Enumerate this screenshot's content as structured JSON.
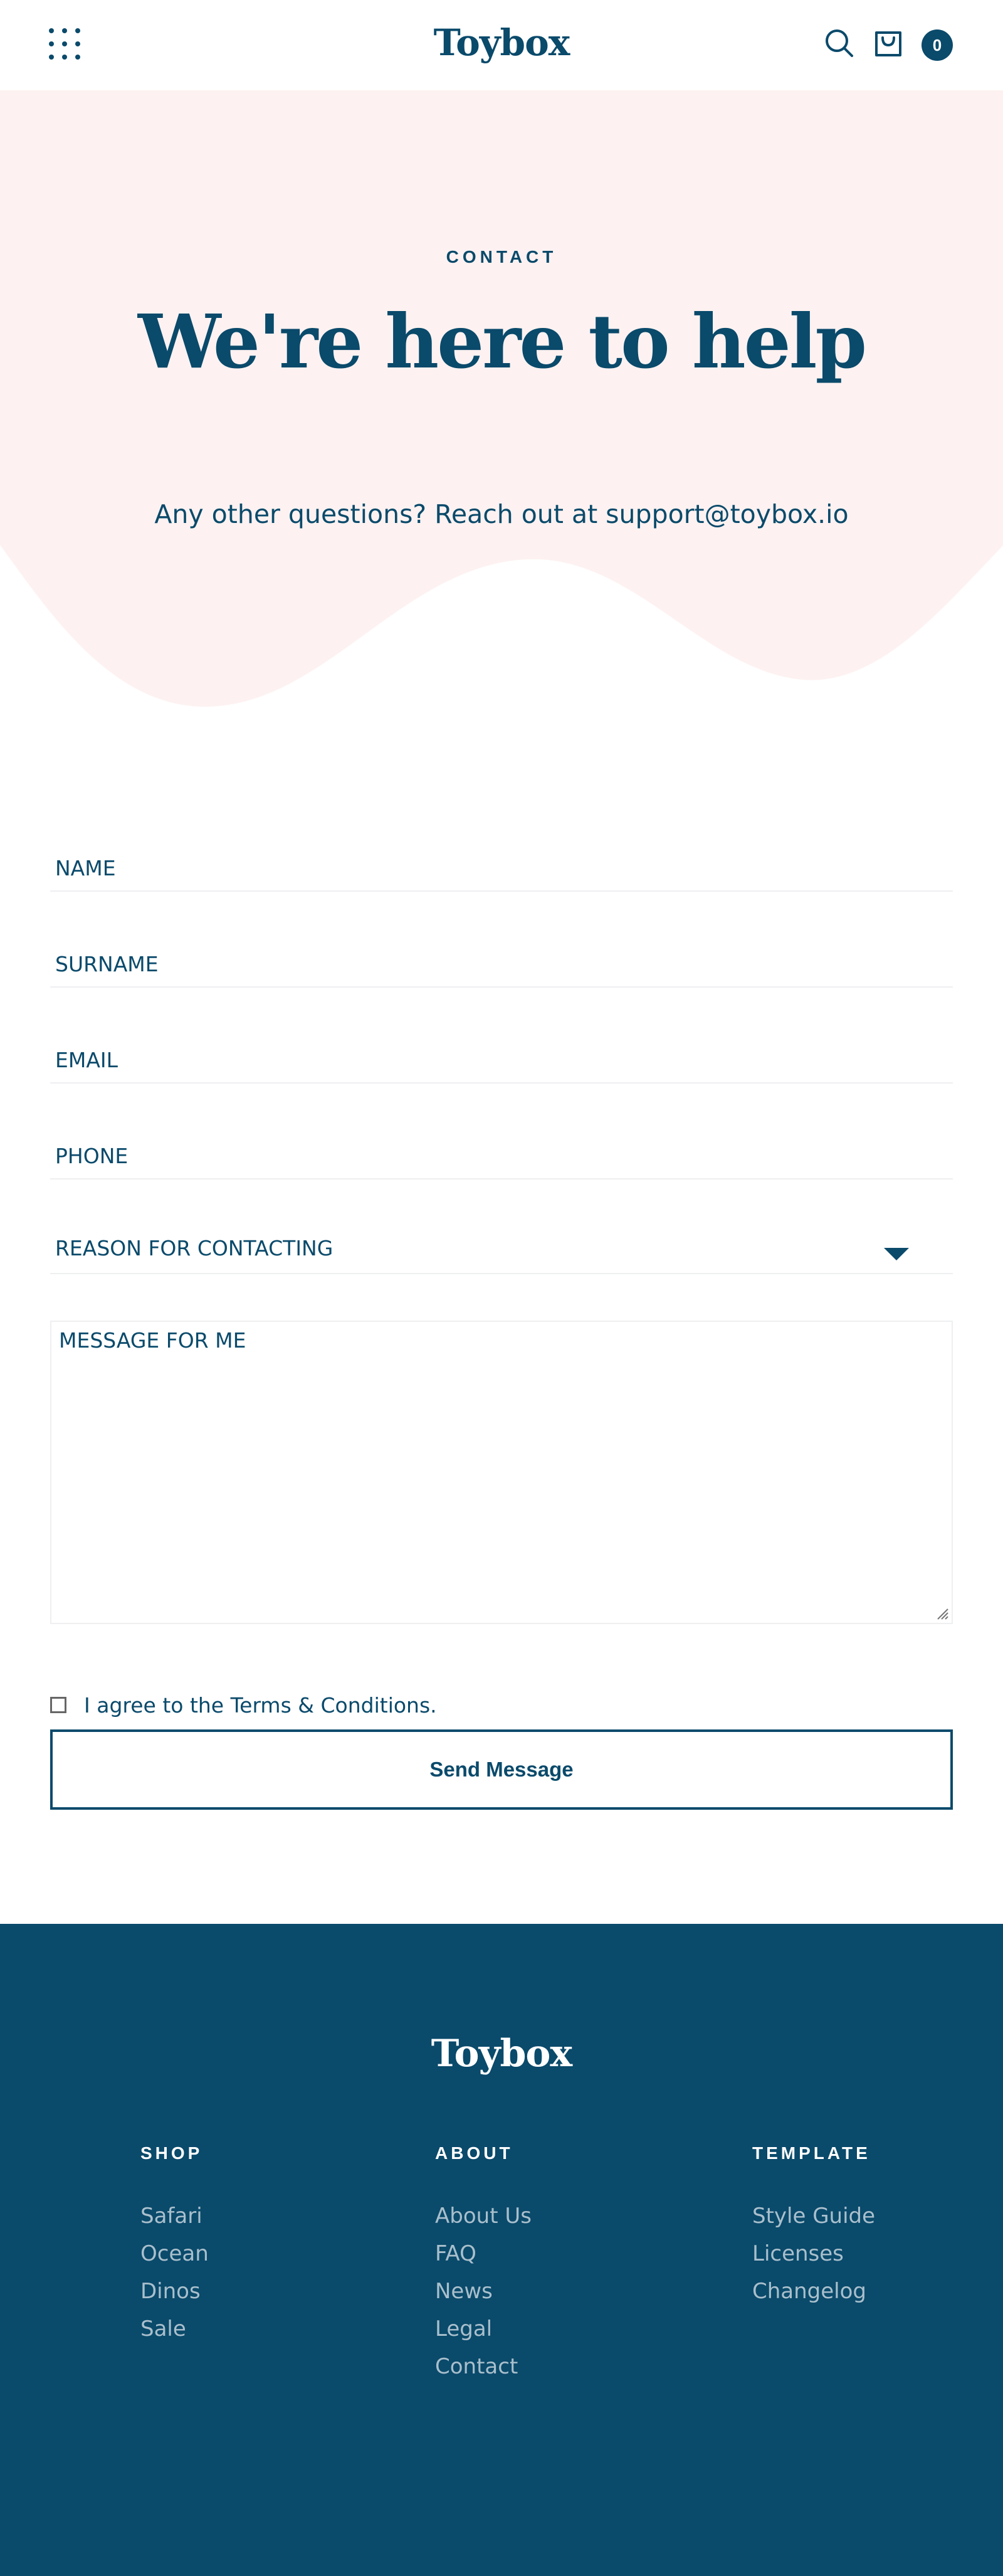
{
  "header": {
    "logo": "Toybox",
    "cart_count": "0",
    "menu_icon": "grid-menu-icon",
    "search_icon": "search-icon",
    "cart_icon": "shopping-bag-icon"
  },
  "hero": {
    "eyebrow": "CONTACT",
    "title": "We're here to help",
    "subtitle": "Any other questions? Reach out at support@toybox.io"
  },
  "form": {
    "name_placeholder": "NAME",
    "surname_placeholder": "SURNAME",
    "email_placeholder": "EMAIL",
    "phone_placeholder": "PHONE",
    "reason_label": "REASON FOR CONTACTING",
    "message_placeholder": "MESSAGE FOR ME",
    "agree_label": "I agree to the Terms & Conditions.",
    "submit_label": "Send Message"
  },
  "footer": {
    "logo": "Toybox",
    "columns": [
      {
        "heading": "SHOP",
        "links": [
          "Safari",
          "Ocean",
          "Dinos",
          "Sale"
        ]
      },
      {
        "heading": "ABOUT",
        "links": [
          "About Us",
          "FAQ",
          "News",
          "Legal",
          "Contact"
        ]
      },
      {
        "heading": "TEMPLATE",
        "links": [
          "Style Guide",
          "Licenses",
          "Changelog"
        ]
      }
    ]
  },
  "colors": {
    "brand": "#0a4a6b",
    "hero_bg": "#fdf2f1",
    "footer_link": "#a9bfcc",
    "field_border": "#eeeff1"
  }
}
